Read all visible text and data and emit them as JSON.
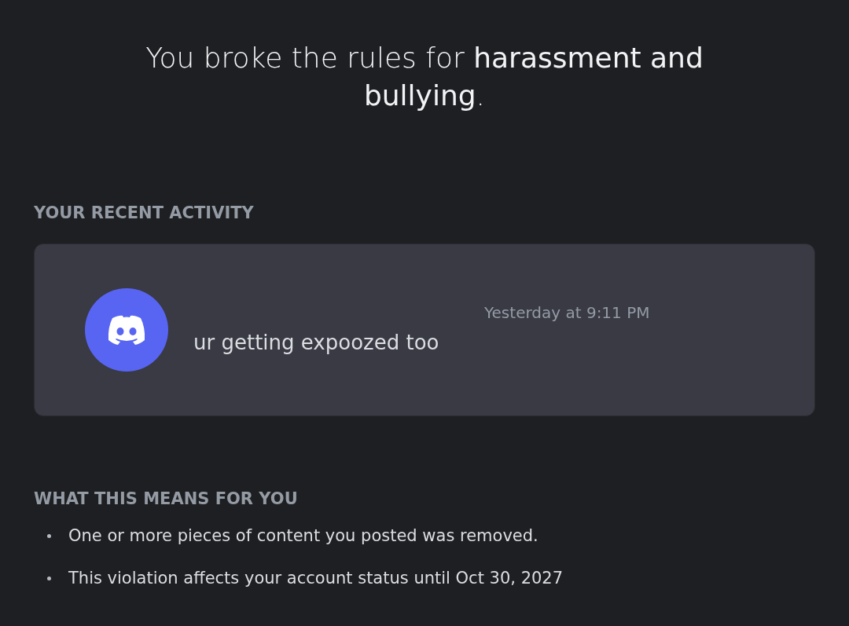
{
  "heading": "You broke the rules for **harassment and bullying**.",
  "recent_activity": {
    "title": "YOUR RECENT ACTIVITY",
    "message": {
      "timestamp": "Yesterday at 9:11 PM",
      "text": "ur getting expoozed too"
    }
  },
  "consequences": {
    "title": "WHAT THIS MEANS FOR YOU",
    "items": [
      "One or more pieces of content you posted was removed.",
      "This violation affects your account status until Oct 30, 2027"
    ]
  }
}
